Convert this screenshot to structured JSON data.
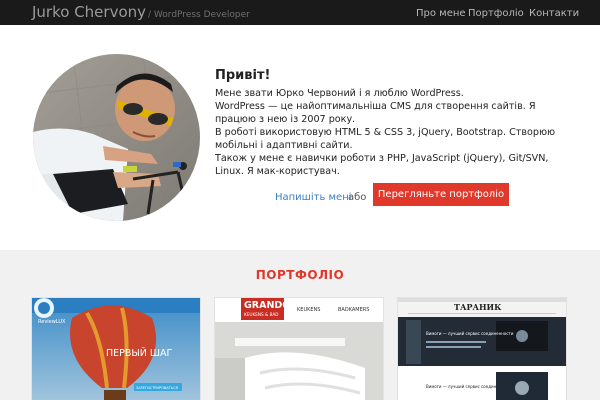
{
  "nav": {
    "brand": "Jurko Chervony",
    "brand_sub": "/ WordPress Developer",
    "items": [
      "Про мене",
      "Портфоліо",
      "Контакти"
    ]
  },
  "hero": {
    "title": "Привіт!",
    "paragraphs": [
      "Мене звати Юрко Червоний і я люблю WordPress.",
      "WordPress — це найоптимальніша CMS для створення сайтів. Я працюю з нею із 2007 року.",
      "В роботі використовую HTML 5 & CSS 3, jQuery, Bootstrap. Створюю мобільні і адаптивні сайти.",
      "Також у мене є навички роботи з PHP, JavaScript (jQuery), Git/SVN, Linux. Я мак-користувач."
    ],
    "contact_link": "Напишіть мені",
    "or_text": "або",
    "portfolio_button": "Перегляньте портфоліо"
  },
  "portfolio": {
    "title": "ПОРТФОЛІО",
    "cards": [
      {
        "logo": "ReviewLUX",
        "headline": "ПЕРВЫЙ ШАГ",
        "cta": "ЗАРЕГИСТРИРОВАТЬСЯ"
      },
      {
        "logo_top": "GRANDO",
        "logo_bottom": "KEUKENS & BAD",
        "menu": [
          "KEUKENS",
          "BADKAMERS"
        ]
      },
      {
        "logo": "ТАРАНИК",
        "heading": "Вимоги — лучший сервис соединенности",
        "heading_2": "Вимоги — лучший сервис соединенности"
      }
    ]
  },
  "colors": {
    "accent": "#e0392b",
    "navbar": "#1a1a1a",
    "link": "#3a7fc1",
    "section_bg": "#f1f1f1"
  }
}
